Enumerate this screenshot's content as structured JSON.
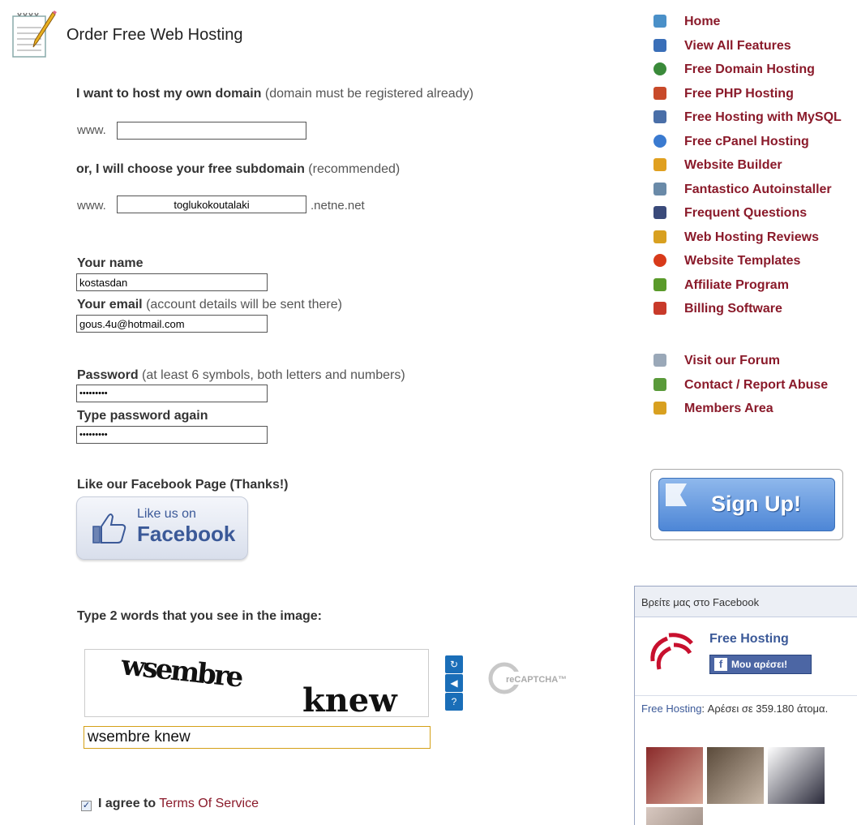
{
  "header": {
    "title": "Order Free Web Hosting",
    "icon": "notepad-pencil-icon"
  },
  "own_domain": {
    "label_bold": "I want to host my own domain",
    "label_note": "(domain must be registered already)",
    "prefix": "www.",
    "value": ""
  },
  "subdomain": {
    "label_bold": "or, I will choose your free subdomain",
    "label_note": "(recommended)",
    "prefix": "www.",
    "value": "toglukokoutalaki",
    "suffix": ".netne.net"
  },
  "name_field": {
    "label": "Your name",
    "value": "kostasdan"
  },
  "email_field": {
    "label": "Your email",
    "note": "(account details will be sent there)",
    "value": "gous.4u@hotmail.com"
  },
  "password_field": {
    "label": "Password",
    "note": "(at least 6 symbols, both letters and numbers)",
    "value": "•••••••••"
  },
  "password_again": {
    "label": "Type password again",
    "value": "•••••••••"
  },
  "facebook_like": {
    "heading": "Like our Facebook Page (Thanks!)",
    "line1": "Like us on",
    "line2": "Facebook"
  },
  "captcha": {
    "prompt": "Type 2 words that you see in the image:",
    "word1": "wsembre",
    "word2": "knew",
    "input_value": "wsembre knew",
    "logo_text": "reCAPTCHA™",
    "buttons": [
      "refresh-icon",
      "audio-icon",
      "help-icon"
    ]
  },
  "agree": {
    "checked": true,
    "prefix": "I agree to",
    "link": "Terms Of Service"
  },
  "nav": {
    "primary": [
      {
        "label": "Home",
        "icon": "home-icon",
        "color": "#4a90c8"
      },
      {
        "label": "View All Features",
        "icon": "checklist-icon",
        "color": "#3a6fb8"
      },
      {
        "label": "Free Domain Hosting",
        "icon": "globe-icon",
        "color": "#3a8a3a"
      },
      {
        "label": "Free PHP Hosting",
        "icon": "php-file-icon",
        "color": "#c84a2a"
      },
      {
        "label": "Free Hosting with MySQL",
        "icon": "database-icon",
        "color": "#4a6fa8"
      },
      {
        "label": "Free cPanel Hosting",
        "icon": "cpanel-icon",
        "color": "#3a7ad0"
      },
      {
        "label": "Website Builder",
        "icon": "builder-icon",
        "color": "#e0a020"
      },
      {
        "label": "Fantastico Autoinstaller",
        "icon": "installer-icon",
        "color": "#6a8aa8"
      },
      {
        "label": "Frequent Questions",
        "icon": "question-icon",
        "color": "#3a4a7a"
      },
      {
        "label": "Web Hosting Reviews",
        "icon": "reviews-icon",
        "color": "#d8a020"
      },
      {
        "label": "Website Templates",
        "icon": "templates-icon",
        "color": "#d83a1a"
      },
      {
        "label": "Affiliate Program",
        "icon": "affiliate-icon",
        "color": "#5a9a2a"
      },
      {
        "label": "Billing Software",
        "icon": "billing-icon",
        "color": "#c83a2a"
      }
    ],
    "secondary": [
      {
        "label": "Visit our Forum",
        "icon": "forum-icon",
        "color": "#9aa8b8"
      },
      {
        "label": "Contact / Report Abuse",
        "icon": "contact-icon",
        "color": "#5a9a3a"
      },
      {
        "label": "Members Area",
        "icon": "lock-icon",
        "color": "#d8a020"
      }
    ]
  },
  "signup": {
    "label": "Sign Up!"
  },
  "fb_widget": {
    "header": "Βρείτε μας στο Facebook",
    "page_name": "Free Hosting",
    "like_label": "Μου αρέσει!",
    "count_name": "Free Hosting",
    "count_text": ": Αρέσει σε 359.180 άτομα."
  }
}
